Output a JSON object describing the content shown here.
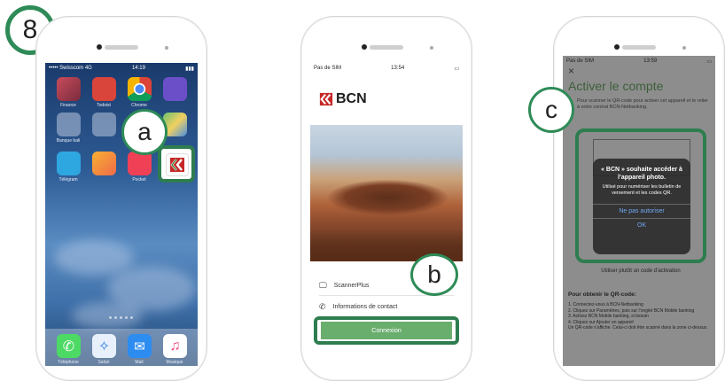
{
  "step_number": "8",
  "callouts": {
    "a": "a",
    "b": "b",
    "c": "c"
  },
  "colors": {
    "accent_green": "#2e7d4f",
    "button_green": "#6aae6e"
  },
  "phone1": {
    "carrier": "••••• Swisscom  4G",
    "time": "14:19",
    "dock": [
      {
        "label": "Téléphone",
        "icon": "phone-app-icon"
      },
      {
        "label": "Safari",
        "icon": "safari-icon"
      },
      {
        "label": "Mail",
        "icon": "mail-icon"
      },
      {
        "label": "Musique",
        "icon": "music-icon"
      }
    ],
    "app_labels": [
      "Finance",
      "Todoist",
      "Chrome",
      "",
      "Banque bali",
      "",
      "",
      "",
      "Télégram",
      "",
      "Pocket",
      ""
    ]
  },
  "phone2": {
    "carrier": "Pas de SIM",
    "time": "13:54",
    "logo_text": "BCN",
    "menu": [
      {
        "label": "ScannerPlus",
        "icon": "monitor-icon"
      },
      {
        "label": "Informations de contact",
        "icon": "phone-handset-icon"
      }
    ],
    "connect_label": "Connexion"
  },
  "phone3": {
    "carrier": "Pas de SIM",
    "time": "13:59",
    "close": "×",
    "title": "Activer le compte",
    "intro": "Pour scanner le QR-code pour activer cet appareil et le relier à votre contrat BCN-Netbanking.",
    "dialog": {
      "title": "« BCN » souhaite accéder à l’appareil photo.",
      "body": "Utilisé pour numériser les bulletin de versement et les codes QR.",
      "deny": "Ne pas autoriser",
      "ok": "OK"
    },
    "alt_link": "Utiliser plutôt un code d’activation",
    "howto_title": "Pour obtenir le QR-code:",
    "howto_steps": "1. Connectez-vous à BCN-Netbanking\n2. Cliquez sur Paramètres, puis sur l’onglet BCN Mobile banking\n3. Activez BCN Mobile banking, si besoin\n4. Cliquez sur Ajouter un appareil\nUn QR-code s’affiche. Celui-ci doit être scanné dans la zone ci-dessus."
  }
}
